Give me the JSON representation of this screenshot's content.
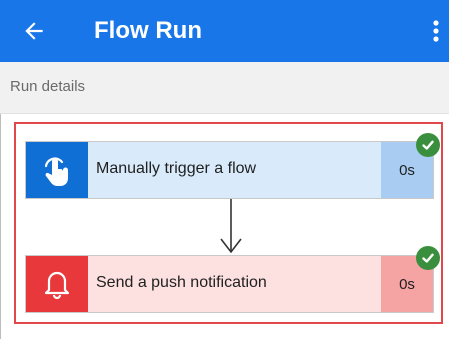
{
  "app_bar": {
    "title": "Flow Run",
    "back_icon": "arrow-left-icon",
    "more_icon": "more-vert-icon",
    "color": "#1976e8"
  },
  "subheader": {
    "title": "Run details"
  },
  "steps": [
    {
      "label": "Manually trigger a flow",
      "duration": "0s",
      "icon": "hand-tap-icon",
      "status": "succeeded",
      "accent_color": "#0f6fd4"
    },
    {
      "label": "Send a push notification",
      "duration": "0s",
      "icon": "bell-icon",
      "status": "succeeded",
      "accent_color": "#e8383b"
    }
  ],
  "status_color": "#3a8f3e",
  "highlight_color": "#e2474b"
}
